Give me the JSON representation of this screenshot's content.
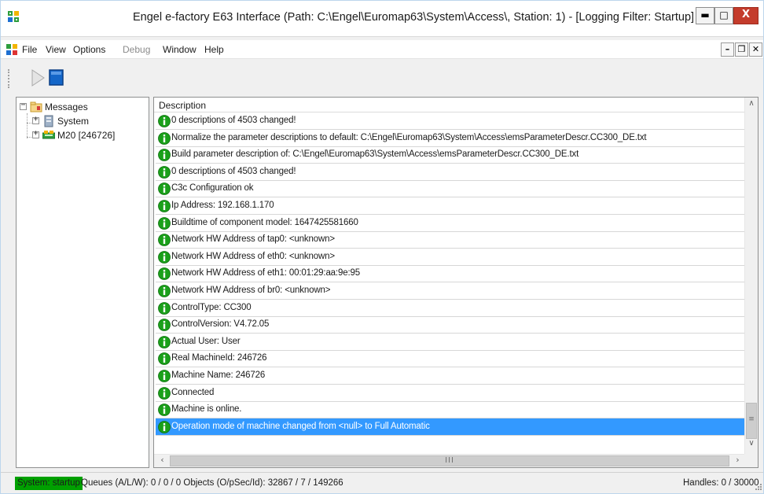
{
  "window": {
    "title": "Engel e-factory E63 Interface (Path: C:\\Engel\\Euromap63\\System\\Access\\, Station: 1) - [Logging Filter: Startup]",
    "min_glyph": "▬",
    "max_glyph": "□",
    "close_glyph": "X"
  },
  "menu": {
    "file": "File",
    "view": "View",
    "options": "Options",
    "debug": "Debug",
    "window": "Window",
    "help": "Help",
    "mdi_min": "–",
    "mdi_restore": "❐",
    "mdi_close": "✕"
  },
  "tree": {
    "root": "Messages",
    "children": [
      {
        "label": "System"
      },
      {
        "label": "M20 [246726]"
      }
    ],
    "expander_plus": "+",
    "expander_minus": "−"
  },
  "list": {
    "header": "Description",
    "rows": [
      "0 descriptions of 4503 changed!",
      "Normalize the parameter descriptions to default: C:\\Engel\\Euromap63\\System\\Access\\emsParameterDescr.CC300_DE.txt",
      "Build parameter description of: C:\\Engel\\Euromap63\\System\\Access\\emsParameterDescr.CC300_DE.txt",
      "0 descriptions of 4503 changed!",
      "C3c Configuration ok",
      "Ip Address:    192.168.1.170",
      "Buildtime of component model: 1647425581660",
      "Network HW Address of tap0:   <unknown>",
      "Network HW Address of eth0:   <unknown>",
      "Network HW Address of eth1:   00:01:29:aa:9e:95",
      "Network HW Address of br0:    <unknown>",
      "ControlType:   CC300",
      "ControlVersion: V4.72.05",
      "Actual User: User",
      "Real MachineId: 246726",
      "Machine Name: 246726",
      "Connected",
      "Machine is online.",
      "Operation mode of machine changed from <null> to Full Automatic"
    ],
    "selected_index": 18,
    "scroll_up": "∧",
    "scroll_down": "∨",
    "scroll_left": "‹",
    "scroll_right": "›",
    "thumb_grip_v": "≡",
    "thumb_grip_h": "III"
  },
  "status": {
    "badge": "System: startup",
    "text": "Queues (A/L/W): 0 / 0 / 0  Objects (O/pSec/Id): 32867 / 7 / 149266",
    "handles": "Handles: 0 / 30000"
  },
  "colors": {
    "selection": "#3399ff",
    "status_badge": "#00a000",
    "info_icon": "#1aa01a",
    "close_button": "#c43c2c"
  }
}
